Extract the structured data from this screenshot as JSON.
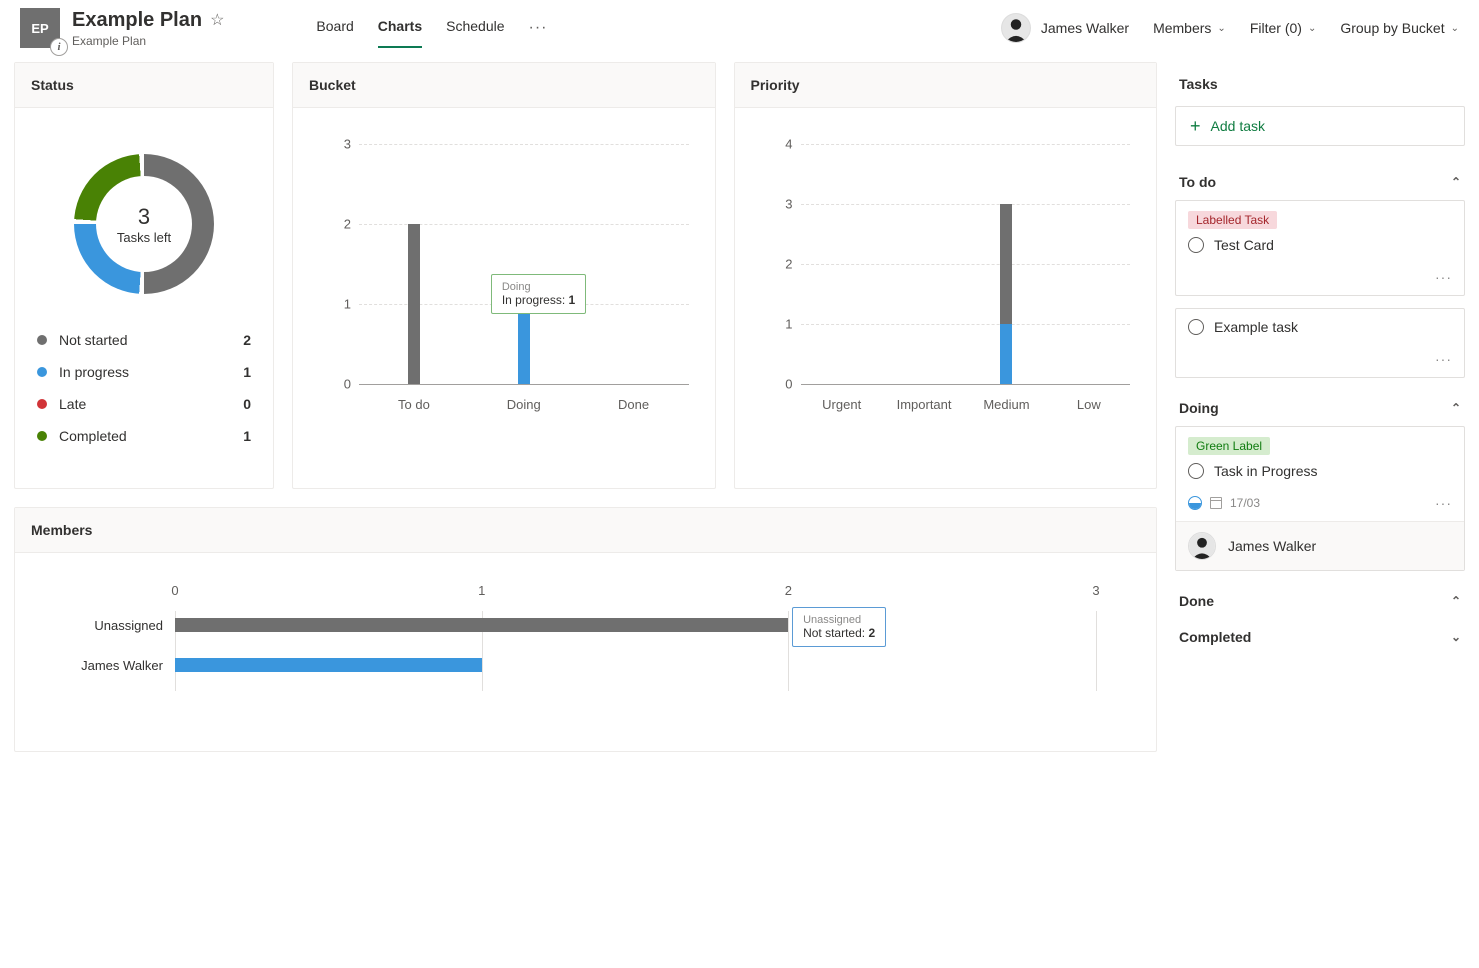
{
  "header": {
    "tile": "EP",
    "plan_name": "Example Plan",
    "plan_sub": "Example Plan",
    "tabs": {
      "board": "Board",
      "charts": "Charts",
      "schedule": "Schedule"
    },
    "user": "James Walker",
    "members_label": "Members",
    "filter_label": "Filter (0)",
    "group_label": "Group by Bucket"
  },
  "status_card": {
    "title": "Status",
    "center_num": "3",
    "center_label": "Tasks left",
    "legend": {
      "not_started": {
        "label": "Not started",
        "value": "2",
        "color": "#6f6f6f"
      },
      "in_progress": {
        "label": "In progress",
        "value": "1",
        "color": "#3a96dd"
      },
      "late": {
        "label": "Late",
        "value": "0",
        "color": "#d13438"
      },
      "completed": {
        "label": "Completed",
        "value": "1",
        "color": "#498205"
      }
    }
  },
  "bucket_card": {
    "title": "Bucket",
    "tooltip": {
      "title": "Doing",
      "line": "In progress:",
      "val": "1"
    }
  },
  "priority_card": {
    "title": "Priority"
  },
  "members_card": {
    "title": "Members",
    "tooltip": {
      "title": "Unassigned",
      "line": "Not started:",
      "val": "2"
    },
    "rows": {
      "unassigned": "Unassigned",
      "james": "James Walker"
    }
  },
  "tasks_panel": {
    "title": "Tasks",
    "add_task": "Add task",
    "groups": {
      "todo": "To do",
      "doing": "Doing",
      "done": "Done",
      "completed": "Completed"
    },
    "card1": {
      "label": "Labelled Task",
      "title": "Test Card"
    },
    "card2": {
      "title": "Example task"
    },
    "card3": {
      "label": "Green Label",
      "title": "Task in Progress",
      "date": "17/03",
      "assignee": "James Walker"
    }
  },
  "chart_data": [
    {
      "type": "pie",
      "title": "Status",
      "series": [
        {
          "name": "Not started",
          "value": 2,
          "color": "#6f6f6f"
        },
        {
          "name": "In progress",
          "value": 1,
          "color": "#3a96dd"
        },
        {
          "name": "Late",
          "value": 0,
          "color": "#d13438"
        },
        {
          "name": "Completed",
          "value": 1,
          "color": "#498205"
        }
      ],
      "center_label": "3 Tasks left"
    },
    {
      "type": "bar",
      "title": "Bucket",
      "categories": [
        "To do",
        "Doing",
        "Done"
      ],
      "series": [
        {
          "name": "Not started",
          "values": [
            2,
            0,
            0
          ],
          "color": "#6f6f6f"
        },
        {
          "name": "In progress",
          "values": [
            0,
            1,
            0
          ],
          "color": "#3a96dd"
        }
      ],
      "ylim": [
        0,
        3
      ],
      "ylabel": ""
    },
    {
      "type": "bar",
      "title": "Priority",
      "categories": [
        "Urgent",
        "Important",
        "Medium",
        "Low"
      ],
      "series": [
        {
          "name": "Not started",
          "values": [
            0,
            0,
            2,
            0
          ],
          "color": "#6f6f6f"
        },
        {
          "name": "In progress",
          "values": [
            0,
            0,
            1,
            0
          ],
          "color": "#3a96dd"
        }
      ],
      "ylim": [
        0,
        4
      ],
      "ylabel": ""
    },
    {
      "type": "bar",
      "title": "Members",
      "orientation": "horizontal",
      "categories": [
        "Unassigned",
        "James Walker"
      ],
      "series": [
        {
          "name": "Not started",
          "values": [
            2,
            0
          ],
          "color": "#6f6f6f"
        },
        {
          "name": "In progress",
          "values": [
            0,
            1
          ],
          "color": "#3a96dd"
        }
      ],
      "xlim": [
        0,
        3
      ]
    }
  ]
}
